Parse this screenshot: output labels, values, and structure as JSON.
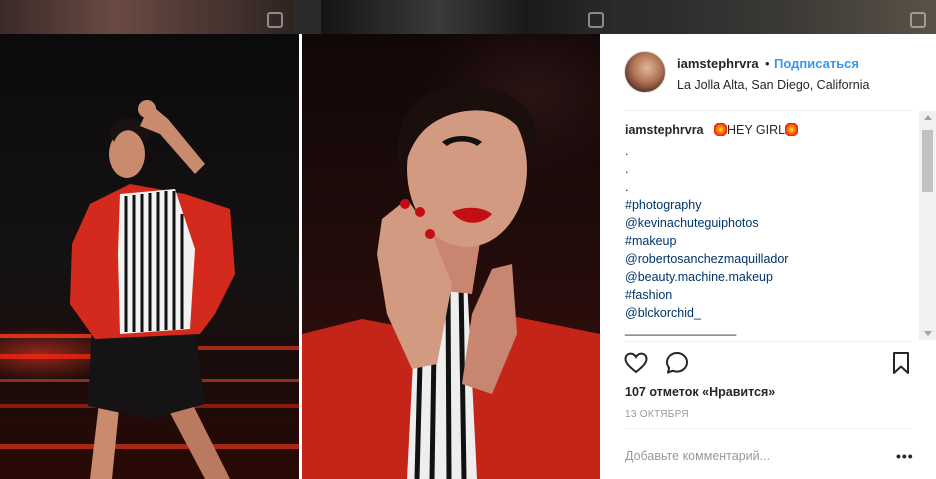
{
  "post": {
    "username": "iamstephrvra",
    "separator": "•",
    "follow_label": "Подписаться",
    "location": "La Jolla Alta, San Diego, California"
  },
  "caption": {
    "username": "iamstephrvra",
    "text": "HEY GIRL",
    "dots": [
      ".",
      ".",
      "."
    ],
    "hashtag_photography": "#photography",
    "mention_1": "@kevinachuteguiphotos",
    "hashtag_makeup": "#makeup",
    "mention_2": "@robertosanchezmaquillador",
    "mention_3": "@beauty.machine.makeup",
    "hashtag_fashion": "#fashion",
    "mention_4": "@blckorchid_",
    "underline": "________________"
  },
  "stats": {
    "likes_label": "107 отметок «Нравится»",
    "date": "13 ОКТЯБРЯ"
  },
  "comment_box": {
    "placeholder": "Добавьте комментарий...",
    "more_label": "•••"
  },
  "icons": {
    "like": "heart-icon",
    "comment": "comment-bubble-icon",
    "save": "bookmark-icon",
    "emoji": "explosion-emoji-icon",
    "multi": "multiple-posts-icon"
  },
  "colors": {
    "link": "#3897f0",
    "tag": "#003569",
    "text": "#262626",
    "muted": "#999999"
  }
}
